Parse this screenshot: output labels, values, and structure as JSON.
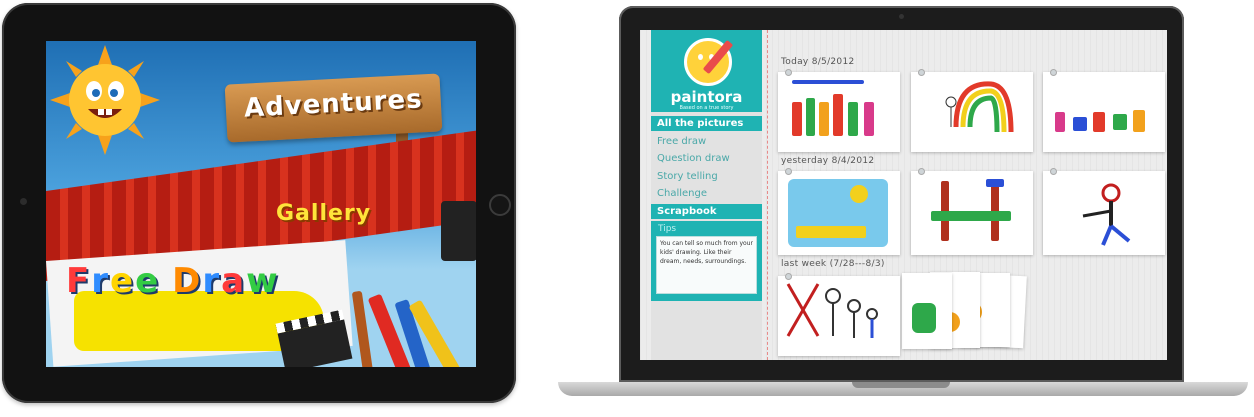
{
  "ipad": {
    "menu": {
      "adventures": "Adventures",
      "gallery": "Gallery",
      "free_draw": "Free Draw"
    },
    "free_draw_colors": [
      "#ff3a3a",
      "#2f8cff",
      "#ffd400",
      "#33cc44",
      "#ff8a00",
      "#2f8cff",
      "#ff3a3a",
      "#33cc44",
      "#ffd400"
    ]
  },
  "mac": {
    "logo": {
      "name": "paintora",
      "tagline": "Based on a true story"
    },
    "nav": [
      {
        "label": "All the pictures",
        "active": true
      },
      {
        "label": "Free draw",
        "active": false
      },
      {
        "label": "Question draw",
        "active": false
      },
      {
        "label": "Story telling",
        "active": false
      },
      {
        "label": "Challenge",
        "active": false
      },
      {
        "label": "Scrapbook",
        "active": true
      }
    ],
    "tips": {
      "label": "Tips",
      "text": "You can tell so much from your kids' drawing. Like their dream, needs, surroundings."
    },
    "sections": {
      "today": "Today 8/5/2012",
      "yesterday": "yesterday  8/4/2012",
      "last_week": "last week (7/28---8/3)"
    },
    "accent": "#1fb3b3"
  }
}
